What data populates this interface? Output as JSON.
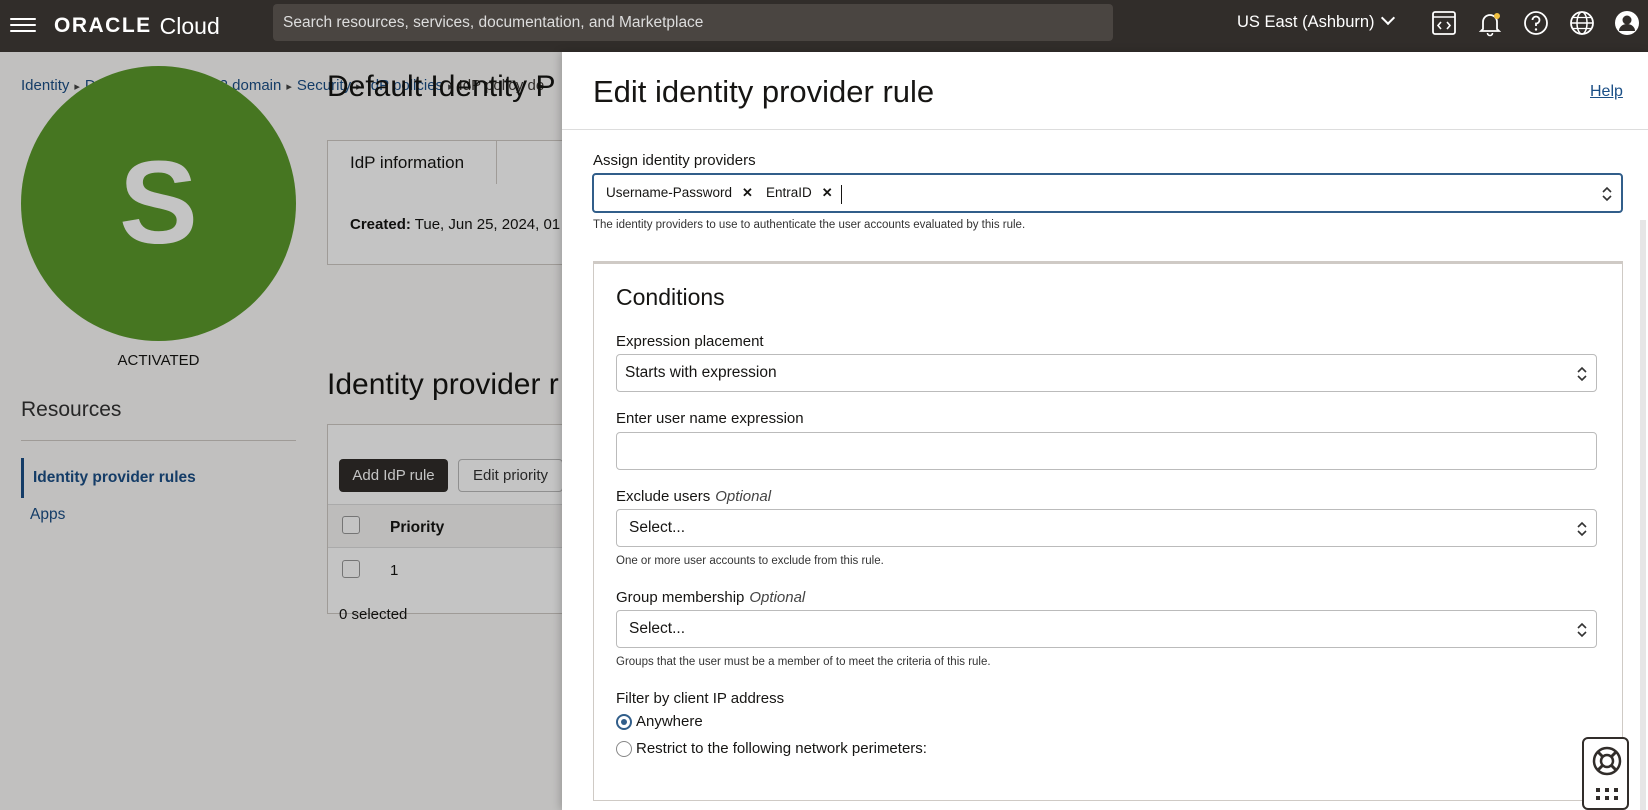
{
  "topbar": {
    "brand": "ORACLE",
    "product": "Cloud",
    "search_placeholder": "Search resources, services, documentation, and Marketplace",
    "region": "US East (Ashburn)"
  },
  "breadcrumb": [
    "Identity",
    "Domains",
    "Domain_2 domain",
    "Security",
    "IdP policies",
    "IdP policy de"
  ],
  "avatar": {
    "letter": "S",
    "status": "ACTIVATED",
    "color": "#5b9a2b"
  },
  "resources": {
    "title": "Resources",
    "items": [
      "Identity provider rules",
      "Apps"
    ]
  },
  "policy": {
    "title": "Default Identity P",
    "tab": "IdP information",
    "created_label": "Created:",
    "created_value": "Tue, Jun 25, 2024, 01"
  },
  "rules": {
    "title": "Identity provider r",
    "add_button": "Add IdP rule",
    "priority_button": "Edit priority",
    "column_priority": "Priority",
    "rows": [
      "1"
    ],
    "selected_count": "0 selected"
  },
  "panel": {
    "title": "Edit identity provider rule",
    "help": "Help",
    "assign_label": "Assign identity providers",
    "assigned": [
      "Username-Password",
      "EntraID"
    ],
    "assign_hint": "The identity providers to use to authenticate the user accounts evaluated by this rule.",
    "conditions_title": "Conditions",
    "expr_placement_label": "Expression placement",
    "expr_placement_value": "Starts with expression",
    "username_expr_label": "Enter user name expression",
    "username_expr_value": "",
    "exclude_label": "Exclude users",
    "exclude_optional": "Optional",
    "exclude_placeholder": "Select...",
    "exclude_hint": "One or more user accounts to exclude from this rule.",
    "group_label": "Group membership",
    "group_optional": "Optional",
    "group_placeholder": "Select...",
    "group_hint": "Groups that the user must be a member of to meet the criteria of this rule.",
    "ip_filter_label": "Filter by client IP address",
    "ip_options": [
      "Anywhere",
      "Restrict to the following network perimeters:"
    ],
    "ip_selected": "Anywhere"
  },
  "colors": {
    "topbar": "#312d2a",
    "link": "#1b4f86",
    "focus": "#315e8a"
  }
}
